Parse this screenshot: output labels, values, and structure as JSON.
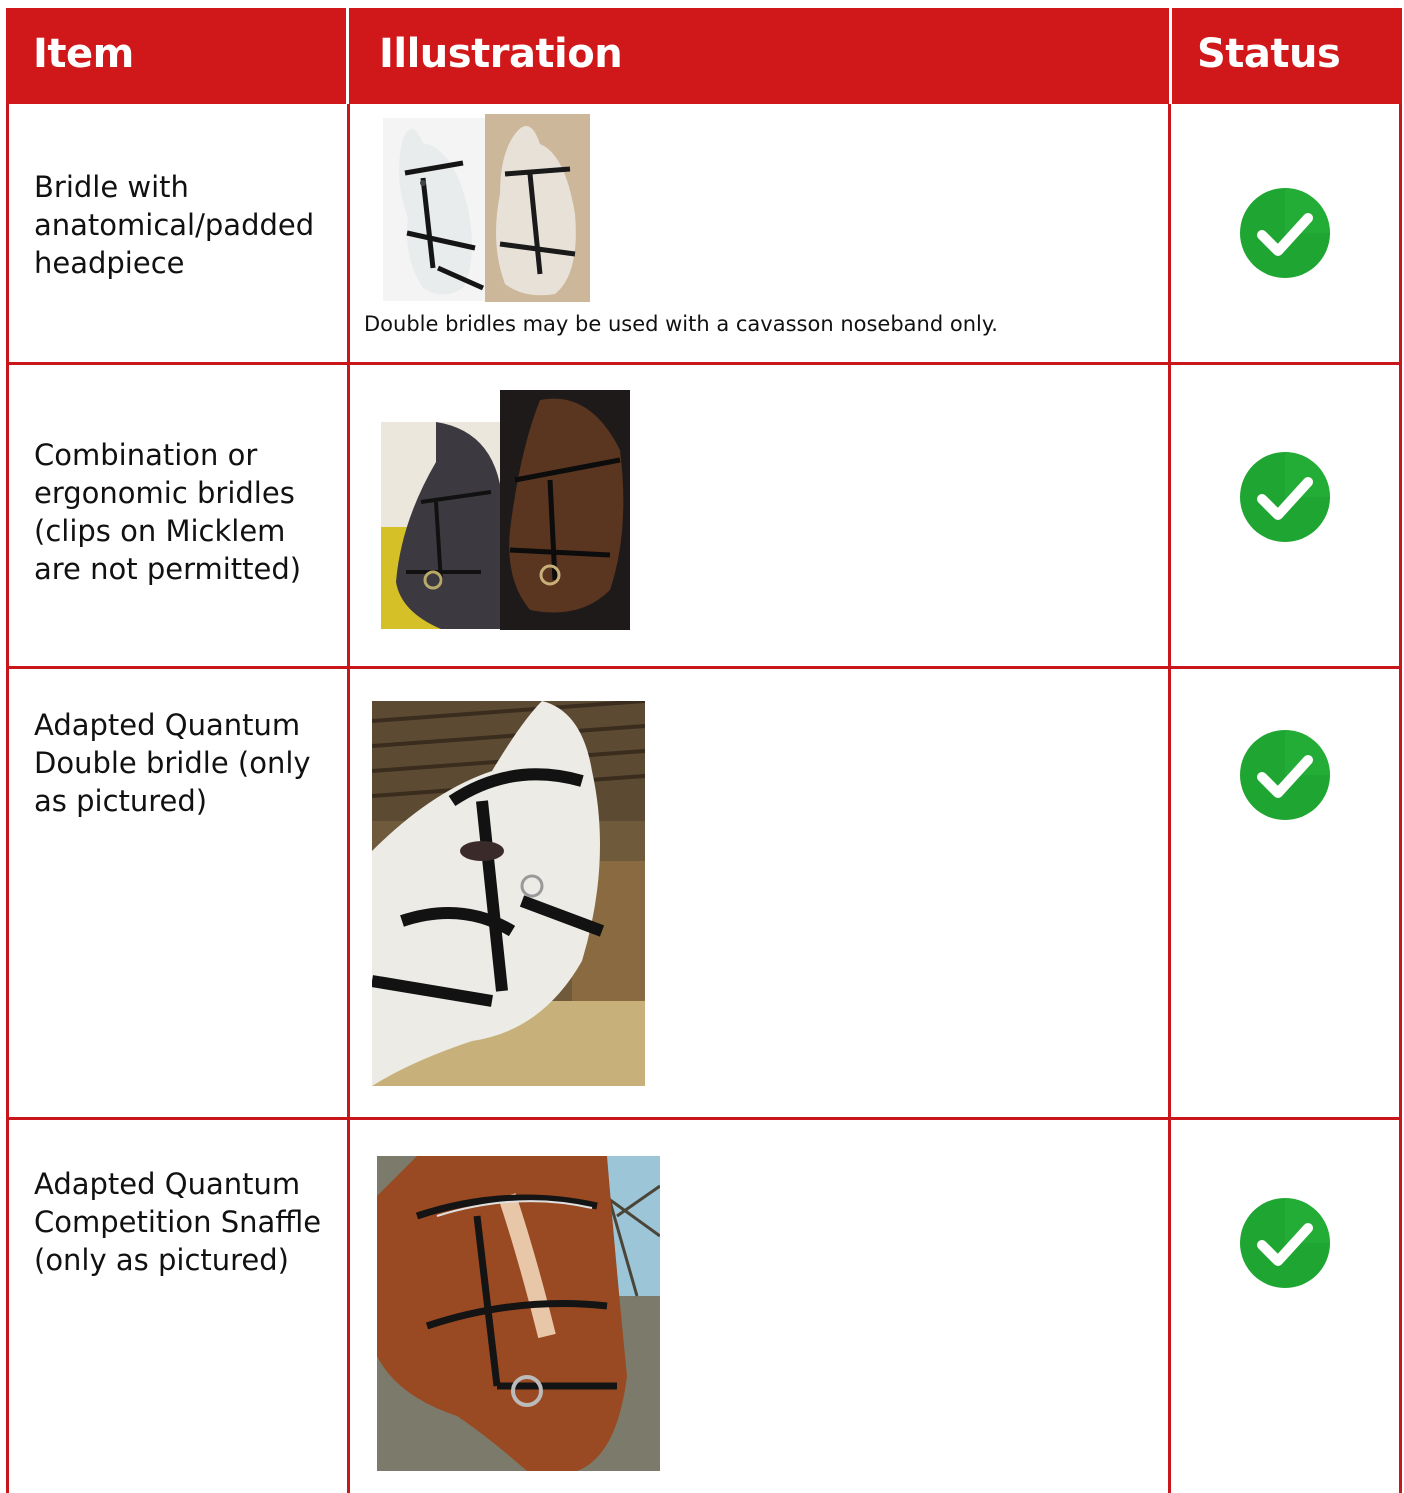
{
  "header": {
    "item": "Item",
    "illustration": "Illustration",
    "status": "Status"
  },
  "colors": {
    "header_red": "#d0171a",
    "check_green": "#1fa531"
  },
  "rows": [
    {
      "item": "Bridle with anatomical/padded headpiece",
      "note": "Double bridles may be used with a cavasson noseband only.",
      "status_icon": "green-check-icon"
    },
    {
      "item": "Combination or ergonomic bridles (clips on Micklem are not permitted)",
      "status_icon": "green-check-icon"
    },
    {
      "item": "Adapted  Quantum Double bridle (only as pictured)",
      "status_icon": "green-check-icon"
    },
    {
      "item": "Adapted Quantum Competition Snaffle (only as pictured)",
      "status_icon": "green-check-icon"
    }
  ]
}
